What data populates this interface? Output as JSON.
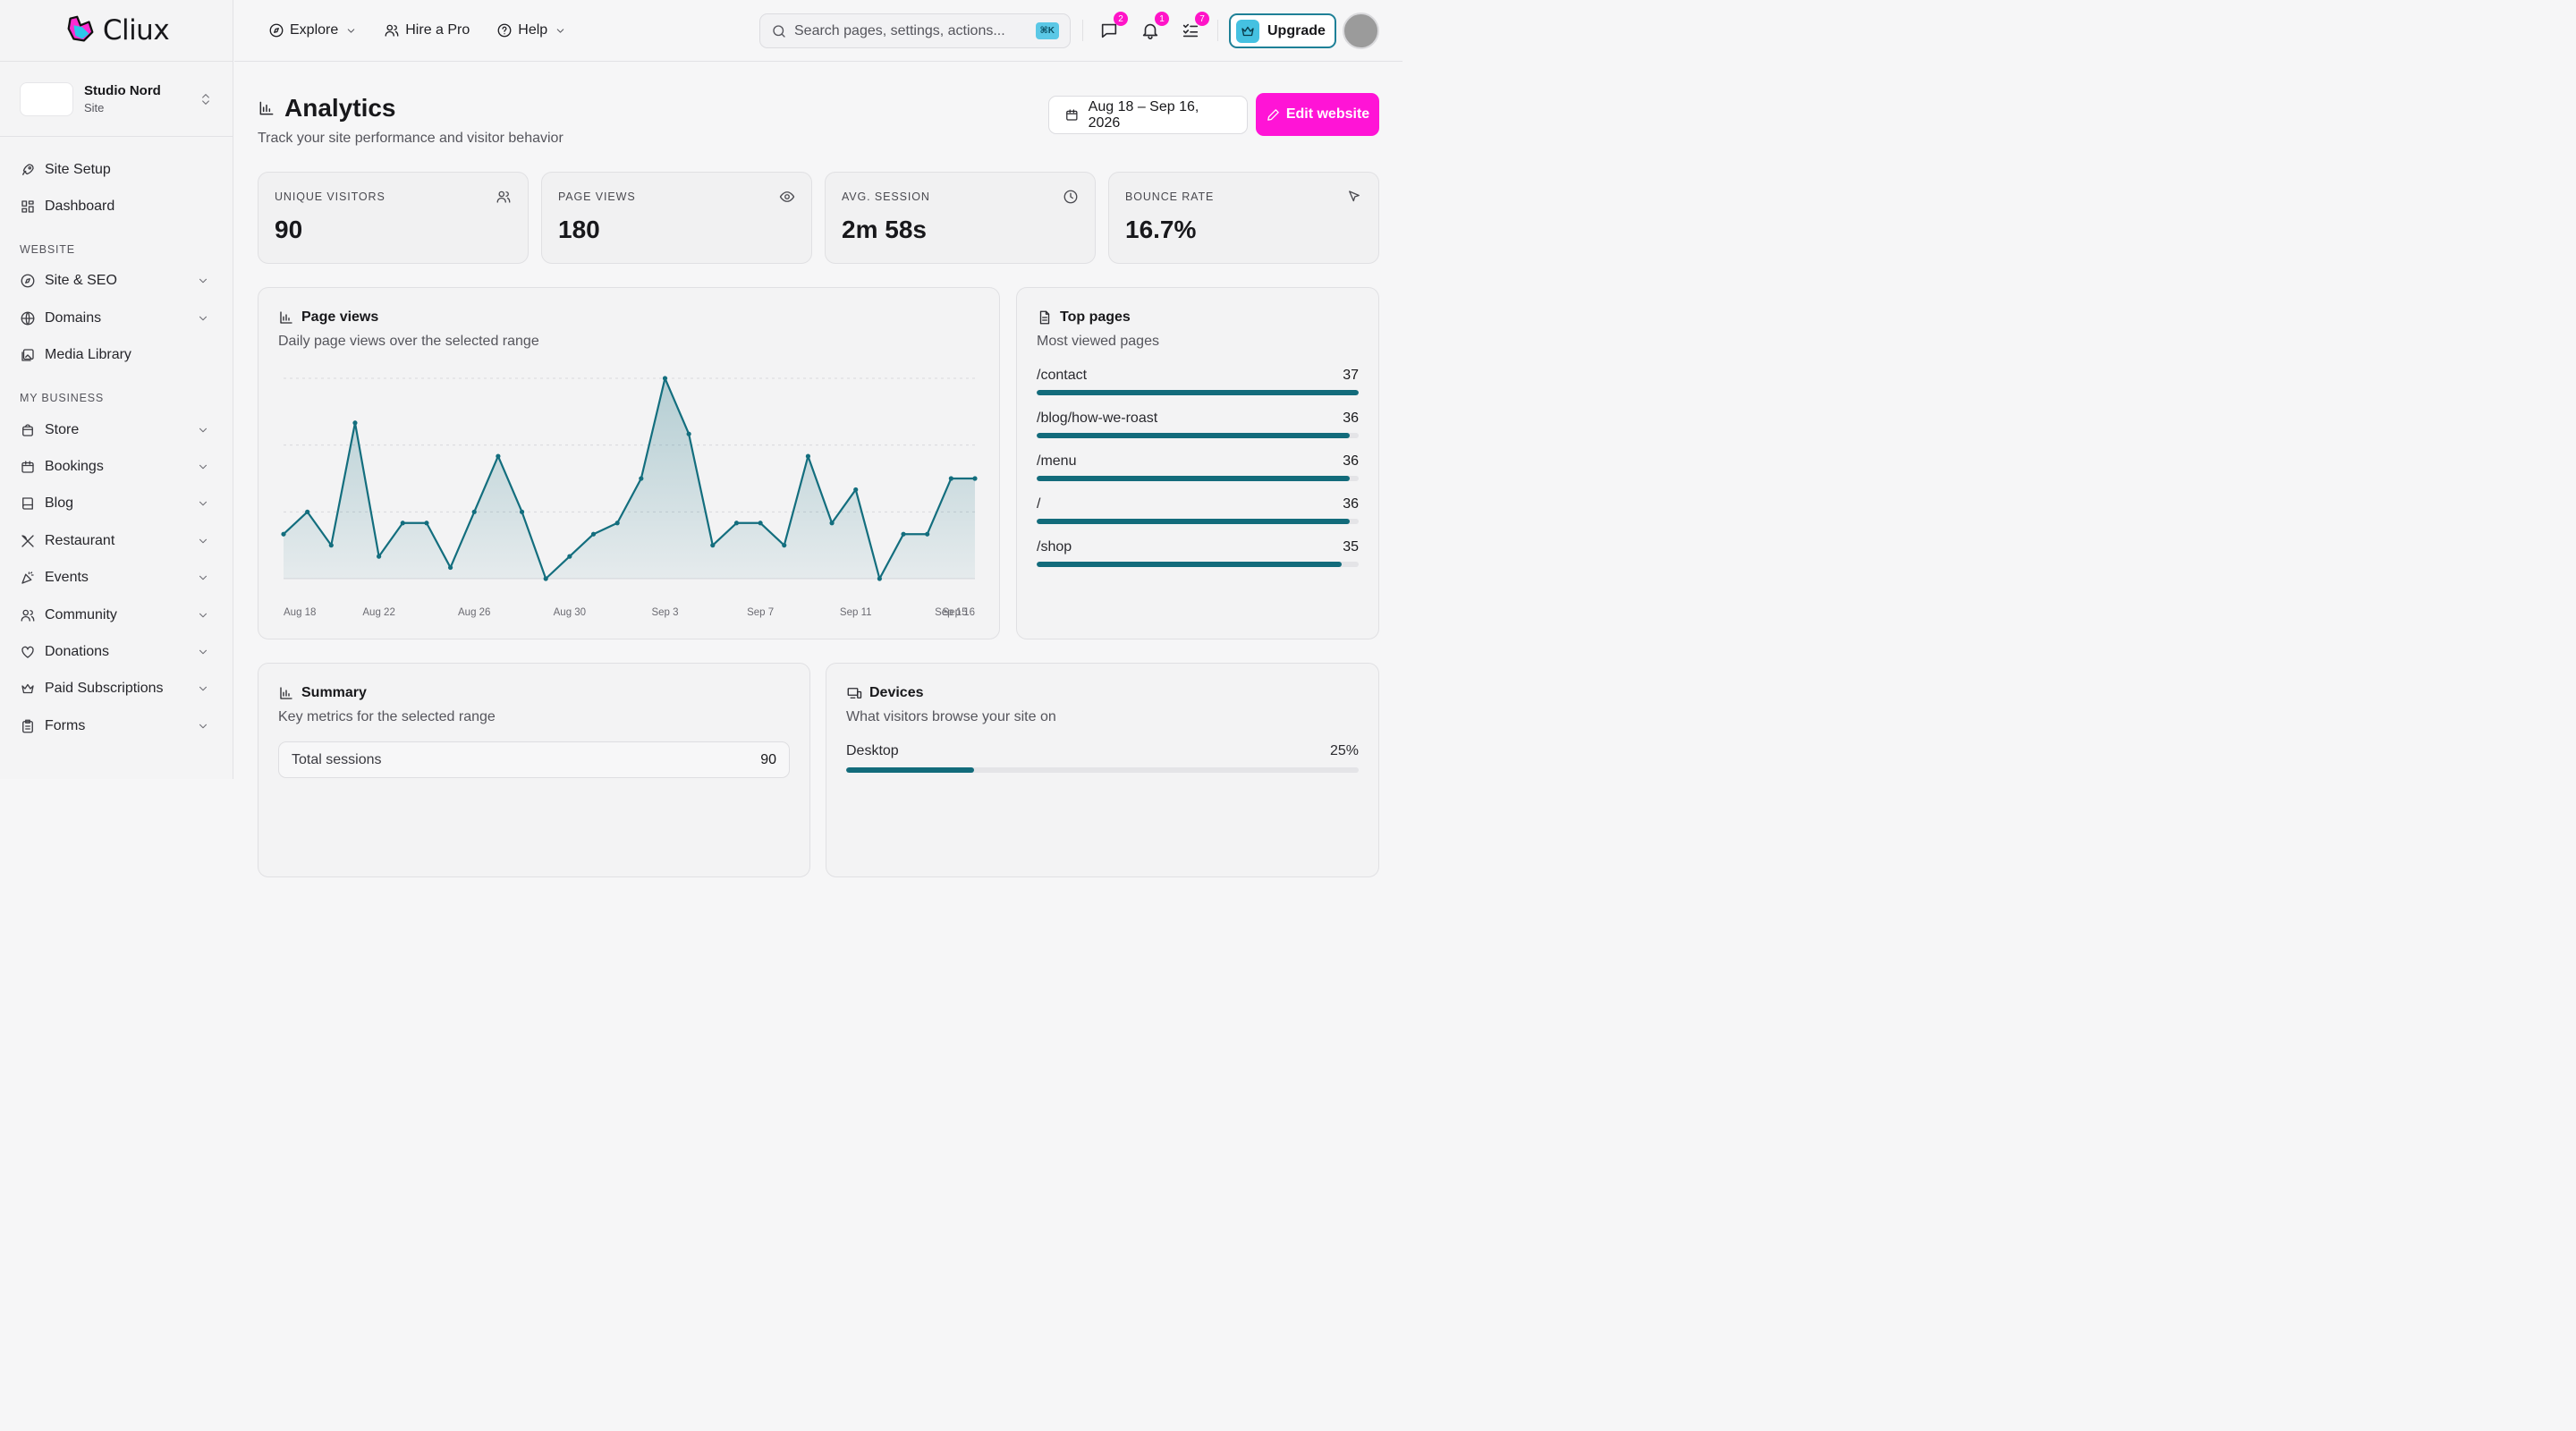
{
  "brand": {
    "name": "Cliux"
  },
  "site": {
    "name": "Studio Nord",
    "type": "Site"
  },
  "sidebar": {
    "top_items": [
      {
        "label": "Site Setup",
        "icon": "rocket-icon"
      },
      {
        "label": "Dashboard",
        "icon": "dashboard-icon"
      }
    ],
    "sections": [
      {
        "title": "WEBSITE",
        "items": [
          {
            "label": "Site & SEO",
            "icon": "compass-icon"
          },
          {
            "label": "Domains",
            "icon": "globe-icon"
          },
          {
            "label": "Media Library",
            "icon": "image-icon"
          }
        ]
      },
      {
        "title": "MY BUSINESS",
        "items": [
          {
            "label": "Store",
            "icon": "store-icon"
          },
          {
            "label": "Bookings",
            "icon": "calendar-icon"
          },
          {
            "label": "Blog",
            "icon": "book-icon"
          },
          {
            "label": "Restaurant",
            "icon": "utensils-icon"
          },
          {
            "label": "Events",
            "icon": "party-icon"
          },
          {
            "label": "Community",
            "icon": "users-icon"
          },
          {
            "label": "Donations",
            "icon": "heart-icon"
          },
          {
            "label": "Paid Subscriptions",
            "icon": "crown-icon"
          },
          {
            "label": "Forms",
            "icon": "clipboard-icon"
          }
        ]
      }
    ]
  },
  "header": {
    "nav": [
      {
        "label": "Explore",
        "icon": "compass-icon",
        "dropdown": true
      },
      {
        "label": "Hire a Pro",
        "icon": "users-icon",
        "dropdown": false
      },
      {
        "label": "Help",
        "icon": "help-circle-icon",
        "dropdown": true
      }
    ],
    "search": {
      "placeholder": "Search pages, settings, actions...",
      "shortcut": "⌘K"
    },
    "badges": {
      "messages": "2",
      "notifications": "1",
      "tasks": "7"
    },
    "upgrade_label": "Upgrade"
  },
  "page": {
    "title": "Analytics",
    "subtitle": "Track your site performance and visitor behavior",
    "date_range": "Aug 18 – Sep 16, 2026",
    "edit_label": "Edit website"
  },
  "stats": [
    {
      "label": "UNIQUE VISITORS",
      "value": "90",
      "icon": "users-icon"
    },
    {
      "label": "PAGE VIEWS",
      "value": "180",
      "icon": "eye-icon"
    },
    {
      "label": "AVG. SESSION",
      "value": "2m 58s",
      "icon": "clock-icon"
    },
    {
      "label": "BOUNCE RATE",
      "value": "16.7%",
      "icon": "pointer-icon"
    }
  ],
  "page_views_card": {
    "title": "Page views",
    "subtitle": "Daily page views over the selected range"
  },
  "chart_data": {
    "type": "area",
    "x": [
      "Aug 18",
      "Aug 19",
      "Aug 20",
      "Aug 21",
      "Aug 22",
      "Aug 23",
      "Aug 24",
      "Aug 25",
      "Aug 26",
      "Aug 27",
      "Aug 28",
      "Aug 29",
      "Aug 30",
      "Aug 31",
      "Sep 1",
      "Sep 2",
      "Sep 3",
      "Sep 4",
      "Sep 5",
      "Sep 6",
      "Sep 7",
      "Sep 8",
      "Sep 9",
      "Sep 10",
      "Sep 11",
      "Sep 12",
      "Sep 13",
      "Sep 14",
      "Sep 15",
      "Sep 16"
    ],
    "tick_labels": [
      "Aug 18",
      "Aug 22",
      "Aug 26",
      "Aug 30",
      "Sep 3",
      "Sep 7",
      "Sep 11",
      "Sep 15",
      "Sep 16"
    ],
    "series": [
      {
        "values": [
          4,
          6,
          3,
          14,
          2,
          5,
          5,
          1,
          6,
          11,
          6,
          0,
          2,
          4,
          5,
          9,
          18,
          13,
          3,
          5,
          5,
          3,
          11,
          5,
          8,
          0,
          4,
          4,
          9,
          9
        ]
      }
    ],
    "ylim": [
      0,
      18
    ],
    "grid": true,
    "color": "#136e7e"
  },
  "top_pages": {
    "title": "Top pages",
    "subtitle": "Most viewed pages",
    "max": 37,
    "items": [
      {
        "path": "/contact",
        "views": 37
      },
      {
        "path": "/blog/how-we-roast",
        "views": 36
      },
      {
        "path": "/menu",
        "views": 36
      },
      {
        "path": "/",
        "views": 36
      },
      {
        "path": "/shop",
        "views": 35
      }
    ]
  },
  "summary": {
    "title": "Summary",
    "subtitle": "Key metrics for the selected range",
    "rows": [
      {
        "label": "Total sessions",
        "value": "90"
      }
    ]
  },
  "devices": {
    "title": "Devices",
    "subtitle": "What visitors browse your site on",
    "items": [
      {
        "label": "Desktop",
        "pct": "25%",
        "fraction": 0.25
      }
    ]
  },
  "colors": {
    "accent": "#ff14d6",
    "teal": "#136e7e",
    "badge": "#ff14c8"
  }
}
